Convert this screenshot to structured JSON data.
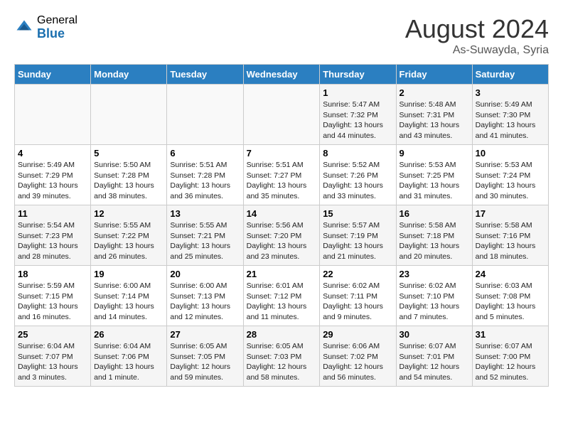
{
  "logo": {
    "general": "General",
    "blue": "Blue"
  },
  "header": {
    "month_year": "August 2024",
    "location": "As-Suwayda, Syria"
  },
  "days_of_week": [
    "Sunday",
    "Monday",
    "Tuesday",
    "Wednesday",
    "Thursday",
    "Friday",
    "Saturday"
  ],
  "weeks": [
    [
      {
        "day": "",
        "info": ""
      },
      {
        "day": "",
        "info": ""
      },
      {
        "day": "",
        "info": ""
      },
      {
        "day": "",
        "info": ""
      },
      {
        "day": "1",
        "info": "Sunrise: 5:47 AM\nSunset: 7:32 PM\nDaylight: 13 hours\nand 44 minutes."
      },
      {
        "day": "2",
        "info": "Sunrise: 5:48 AM\nSunset: 7:31 PM\nDaylight: 13 hours\nand 43 minutes."
      },
      {
        "day": "3",
        "info": "Sunrise: 5:49 AM\nSunset: 7:30 PM\nDaylight: 13 hours\nand 41 minutes."
      }
    ],
    [
      {
        "day": "4",
        "info": "Sunrise: 5:49 AM\nSunset: 7:29 PM\nDaylight: 13 hours\nand 39 minutes."
      },
      {
        "day": "5",
        "info": "Sunrise: 5:50 AM\nSunset: 7:28 PM\nDaylight: 13 hours\nand 38 minutes."
      },
      {
        "day": "6",
        "info": "Sunrise: 5:51 AM\nSunset: 7:28 PM\nDaylight: 13 hours\nand 36 minutes."
      },
      {
        "day": "7",
        "info": "Sunrise: 5:51 AM\nSunset: 7:27 PM\nDaylight: 13 hours\nand 35 minutes."
      },
      {
        "day": "8",
        "info": "Sunrise: 5:52 AM\nSunset: 7:26 PM\nDaylight: 13 hours\nand 33 minutes."
      },
      {
        "day": "9",
        "info": "Sunrise: 5:53 AM\nSunset: 7:25 PM\nDaylight: 13 hours\nand 31 minutes."
      },
      {
        "day": "10",
        "info": "Sunrise: 5:53 AM\nSunset: 7:24 PM\nDaylight: 13 hours\nand 30 minutes."
      }
    ],
    [
      {
        "day": "11",
        "info": "Sunrise: 5:54 AM\nSunset: 7:23 PM\nDaylight: 13 hours\nand 28 minutes."
      },
      {
        "day": "12",
        "info": "Sunrise: 5:55 AM\nSunset: 7:22 PM\nDaylight: 13 hours\nand 26 minutes."
      },
      {
        "day": "13",
        "info": "Sunrise: 5:55 AM\nSunset: 7:21 PM\nDaylight: 13 hours\nand 25 minutes."
      },
      {
        "day": "14",
        "info": "Sunrise: 5:56 AM\nSunset: 7:20 PM\nDaylight: 13 hours\nand 23 minutes."
      },
      {
        "day": "15",
        "info": "Sunrise: 5:57 AM\nSunset: 7:19 PM\nDaylight: 13 hours\nand 21 minutes."
      },
      {
        "day": "16",
        "info": "Sunrise: 5:58 AM\nSunset: 7:18 PM\nDaylight: 13 hours\nand 20 minutes."
      },
      {
        "day": "17",
        "info": "Sunrise: 5:58 AM\nSunset: 7:16 PM\nDaylight: 13 hours\nand 18 minutes."
      }
    ],
    [
      {
        "day": "18",
        "info": "Sunrise: 5:59 AM\nSunset: 7:15 PM\nDaylight: 13 hours\nand 16 minutes."
      },
      {
        "day": "19",
        "info": "Sunrise: 6:00 AM\nSunset: 7:14 PM\nDaylight: 13 hours\nand 14 minutes."
      },
      {
        "day": "20",
        "info": "Sunrise: 6:00 AM\nSunset: 7:13 PM\nDaylight: 13 hours\nand 12 minutes."
      },
      {
        "day": "21",
        "info": "Sunrise: 6:01 AM\nSunset: 7:12 PM\nDaylight: 13 hours\nand 11 minutes."
      },
      {
        "day": "22",
        "info": "Sunrise: 6:02 AM\nSunset: 7:11 PM\nDaylight: 13 hours\nand 9 minutes."
      },
      {
        "day": "23",
        "info": "Sunrise: 6:02 AM\nSunset: 7:10 PM\nDaylight: 13 hours\nand 7 minutes."
      },
      {
        "day": "24",
        "info": "Sunrise: 6:03 AM\nSunset: 7:08 PM\nDaylight: 13 hours\nand 5 minutes."
      }
    ],
    [
      {
        "day": "25",
        "info": "Sunrise: 6:04 AM\nSunset: 7:07 PM\nDaylight: 13 hours\nand 3 minutes."
      },
      {
        "day": "26",
        "info": "Sunrise: 6:04 AM\nSunset: 7:06 PM\nDaylight: 13 hours\nand 1 minute."
      },
      {
        "day": "27",
        "info": "Sunrise: 6:05 AM\nSunset: 7:05 PM\nDaylight: 12 hours\nand 59 minutes."
      },
      {
        "day": "28",
        "info": "Sunrise: 6:05 AM\nSunset: 7:03 PM\nDaylight: 12 hours\nand 58 minutes."
      },
      {
        "day": "29",
        "info": "Sunrise: 6:06 AM\nSunset: 7:02 PM\nDaylight: 12 hours\nand 56 minutes."
      },
      {
        "day": "30",
        "info": "Sunrise: 6:07 AM\nSunset: 7:01 PM\nDaylight: 12 hours\nand 54 minutes."
      },
      {
        "day": "31",
        "info": "Sunrise: 6:07 AM\nSunset: 7:00 PM\nDaylight: 12 hours\nand 52 minutes."
      }
    ]
  ]
}
